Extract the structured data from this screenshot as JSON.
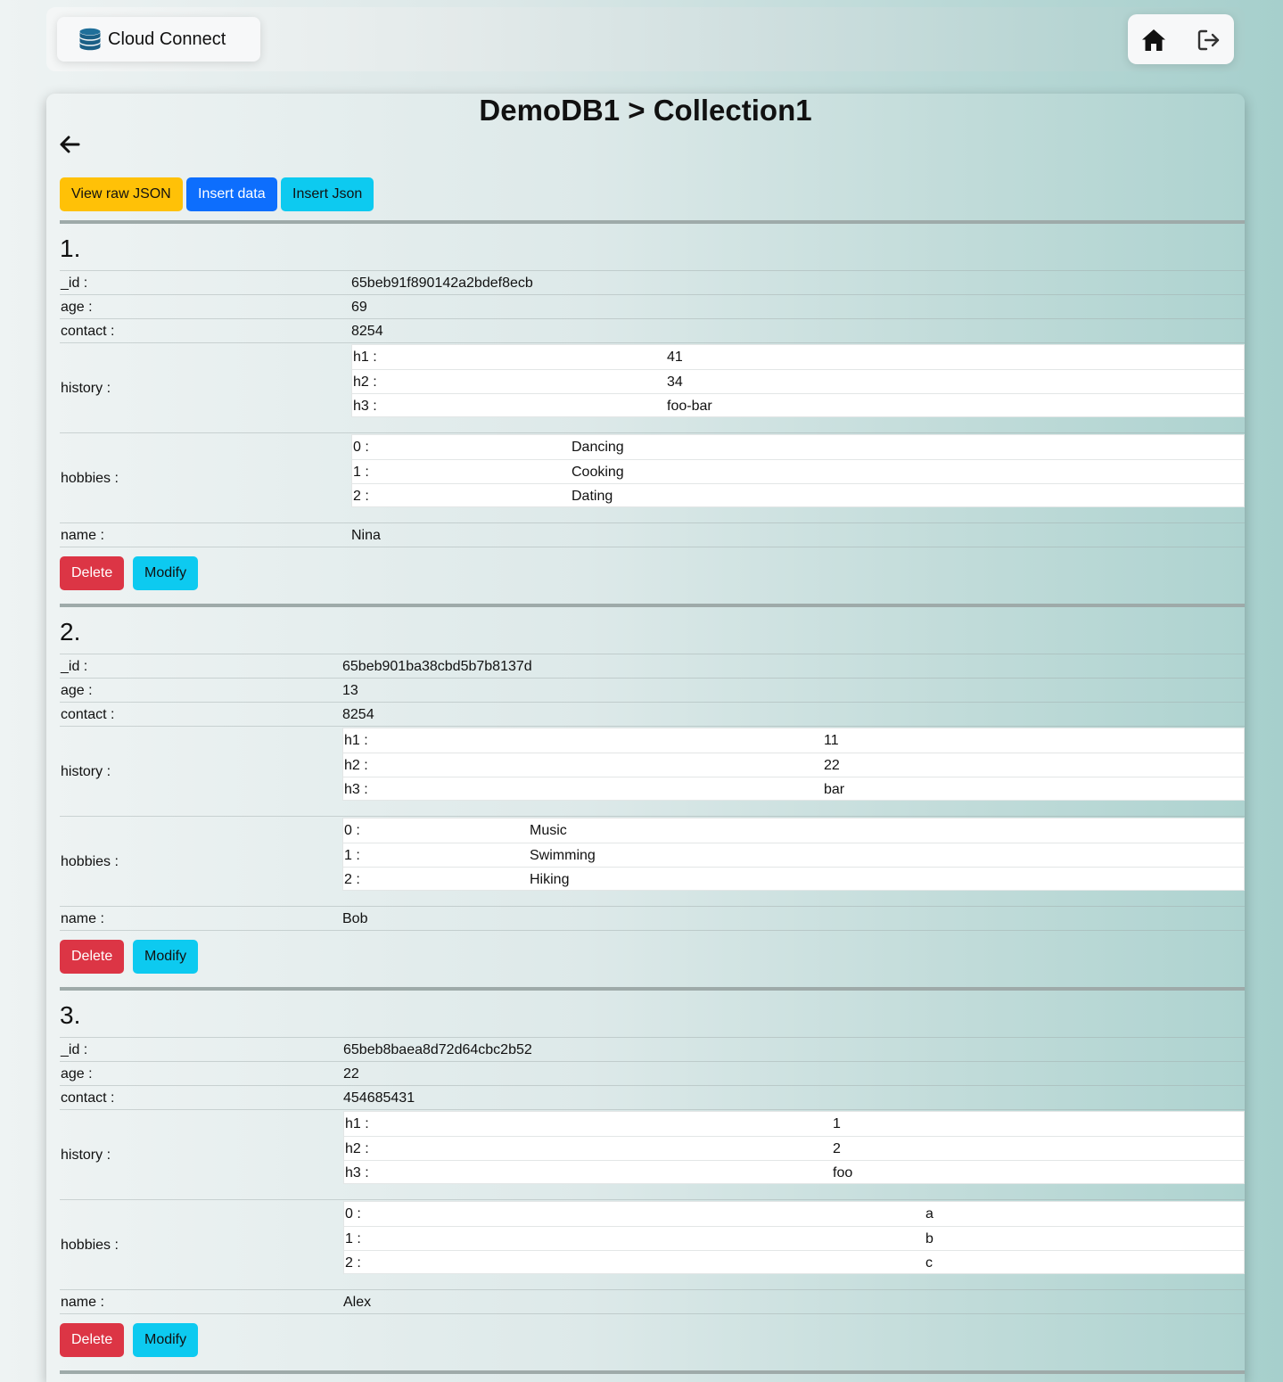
{
  "app": {
    "brand": "Cloud Connect",
    "nav_icons": [
      "home-icon",
      "logout-icon"
    ]
  },
  "page": {
    "title": "DemoDB1 > Collection1",
    "back_icon": "arrow-left-icon"
  },
  "toolbar": {
    "view_raw": "View raw JSON",
    "insert_data": "Insert data",
    "insert_json": "Insert Json"
  },
  "colors": {
    "warning": "#ffc107",
    "primary": "#0d6efd",
    "info": "#0dcaf0",
    "danger": "#dc3545"
  },
  "records": [
    {
      "index": "1.",
      "id_key": "_id :",
      "id_val": "65beb91f890142a2bdef8ecb",
      "age_key": "age :",
      "age_val": "69",
      "contact_key": "contact :",
      "contact_val": "8254",
      "history_key": "history :",
      "history": [
        {
          "k": "h1 :",
          "v": "41"
        },
        {
          "k": "h2 :",
          "v": "34"
        },
        {
          "k": "h3 :",
          "v": "foo-bar"
        }
      ],
      "hobbies_key": "hobbies :",
      "hobbies": [
        {
          "k": "0 :",
          "v": "Dancing"
        },
        {
          "k": "1 :",
          "v": "Cooking"
        },
        {
          "k": "2 :",
          "v": "Dating"
        }
      ],
      "name_key": "name :",
      "name_val": "Nina",
      "delete": "Delete",
      "modify": "Modify"
    },
    {
      "index": "2.",
      "id_key": "_id :",
      "id_val": "65beb901ba38cbd5b7b8137d",
      "age_key": "age :",
      "age_val": "13",
      "contact_key": "contact :",
      "contact_val": "8254",
      "history_key": "history :",
      "history": [
        {
          "k": "h1 :",
          "v": "11"
        },
        {
          "k": "h2 :",
          "v": "22"
        },
        {
          "k": "h3 :",
          "v": "bar"
        }
      ],
      "hobbies_key": "hobbies :",
      "hobbies": [
        {
          "k": "0 :",
          "v": "Music"
        },
        {
          "k": "1 :",
          "v": "Swimming"
        },
        {
          "k": "2 :",
          "v": "Hiking"
        }
      ],
      "name_key": "name :",
      "name_val": "Bob",
      "delete": "Delete",
      "modify": "Modify"
    },
    {
      "index": "3.",
      "id_key": "_id :",
      "id_val": "65beb8baea8d72d64cbc2b52",
      "age_key": "age :",
      "age_val": "22",
      "contact_key": "contact :",
      "contact_val": "454685431",
      "history_key": "history :",
      "history": [
        {
          "k": "h1 :",
          "v": "1"
        },
        {
          "k": "h2 :",
          "v": "2"
        },
        {
          "k": "h3 :",
          "v": "foo"
        }
      ],
      "hobbies_key": "hobbies :",
      "hobbies": [
        {
          "k": "0 :",
          "v": "a"
        },
        {
          "k": "1 :",
          "v": "b"
        },
        {
          "k": "2 :",
          "v": "c"
        }
      ],
      "name_key": "name :",
      "name_val": "Alex",
      "delete": "Delete",
      "modify": "Modify"
    }
  ]
}
